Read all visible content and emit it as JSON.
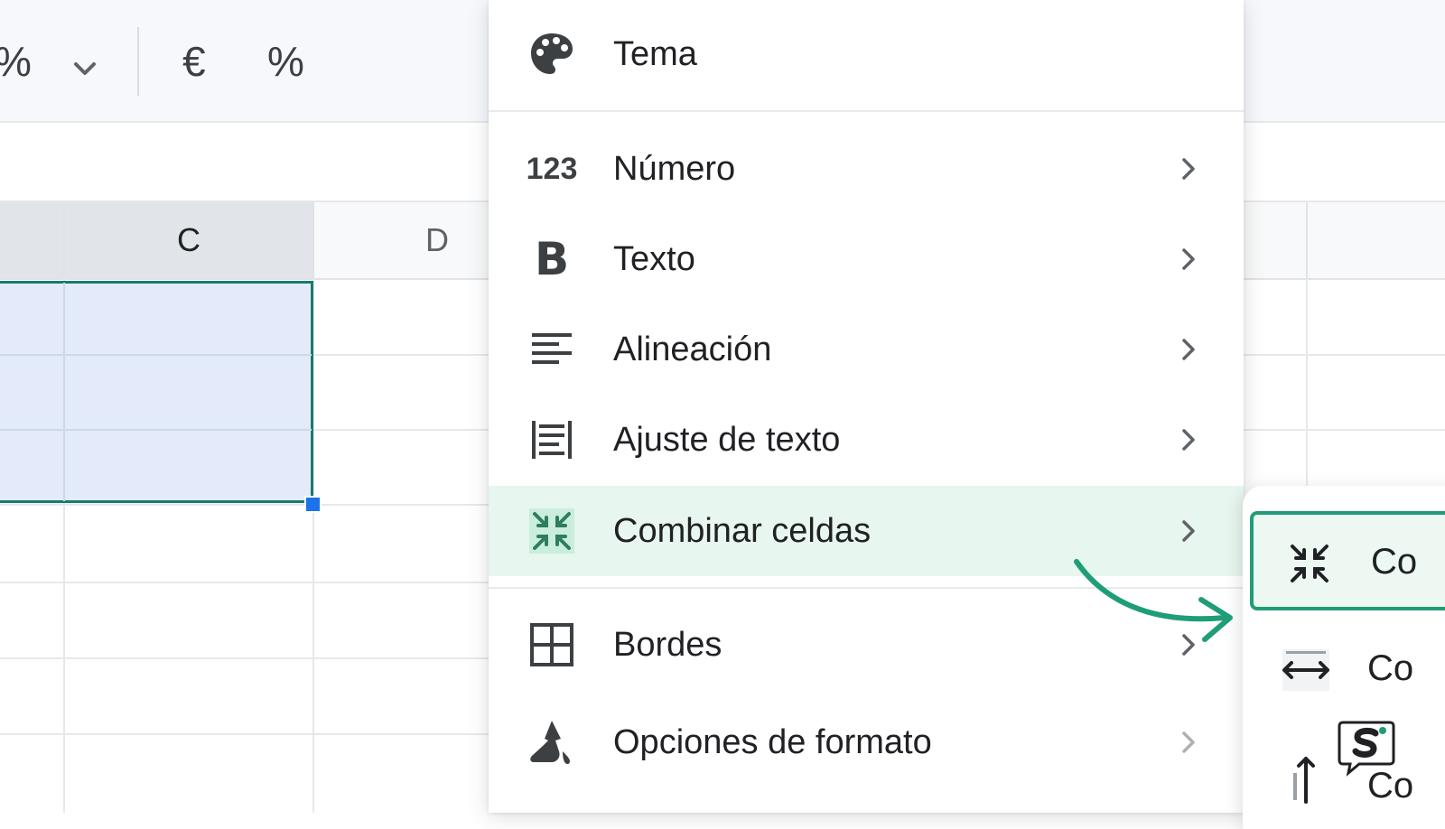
{
  "toolbar": {
    "percent_fragment": "%",
    "dropdown_icon": "chevron-down-icon",
    "currency_symbol": "€",
    "percent_symbol": "%"
  },
  "grid": {
    "columns": [
      "C",
      "D"
    ],
    "selected_column": "C"
  },
  "menu": {
    "items": [
      {
        "label": "Tema",
        "icon": "palette-icon",
        "has_submenu": false
      },
      {
        "label": "Número",
        "icon": "number-format-icon",
        "icon_text": "123",
        "has_submenu": true
      },
      {
        "label": "Texto",
        "icon": "bold-icon",
        "icon_text": "B",
        "has_submenu": true
      },
      {
        "label": "Alineación",
        "icon": "align-left-icon",
        "has_submenu": true
      },
      {
        "label": "Ajuste de texto",
        "icon": "text-wrap-icon",
        "has_submenu": true
      },
      {
        "label": "Combinar celdas",
        "icon": "merge-cells-icon",
        "has_submenu": true,
        "active": true
      },
      {
        "label": "Bordes",
        "icon": "borders-icon",
        "has_submenu": true
      },
      {
        "label": "Opciones de formato",
        "icon": "paint-format-icon",
        "has_submenu": true
      }
    ]
  },
  "submenu": {
    "items": [
      {
        "label": "Co",
        "icon": "merge-all-icon",
        "highlighted": true
      },
      {
        "label": "Co",
        "icon": "merge-horizontal-icon"
      },
      {
        "label": "Co",
        "icon": "merge-vertical-icon"
      }
    ]
  },
  "colors": {
    "accent": "#1f9d78",
    "selection_fill": "#e3ebfa",
    "selection_border": "#177a6e",
    "active_row": "#e7f6ee",
    "fill_handle": "#1a73e8"
  }
}
